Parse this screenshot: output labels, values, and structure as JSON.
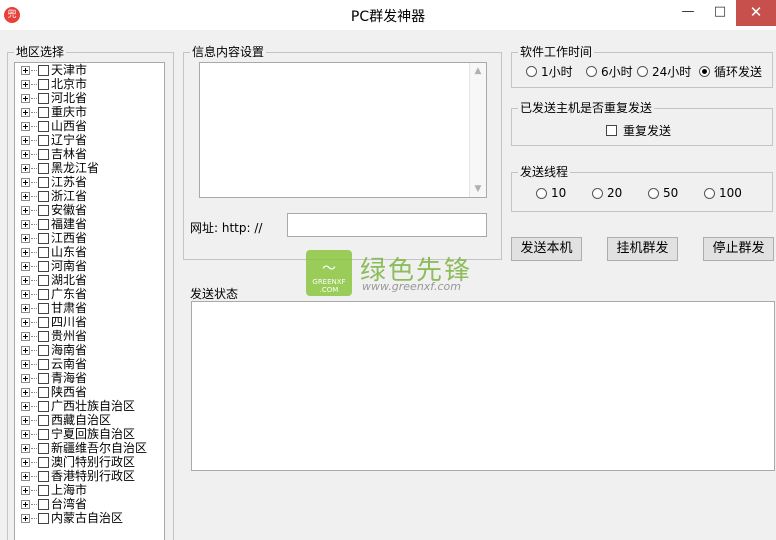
{
  "window": {
    "title": "PC群发神器",
    "icon_text": "兜",
    "min_glyph": "—",
    "max_glyph": "□",
    "close_glyph": "✕"
  },
  "region": {
    "label": "地区选择",
    "items": [
      "天津市",
      "北京市",
      "河北省",
      "重庆市",
      "山西省",
      "辽宁省",
      "吉林省",
      "黑龙江省",
      "江苏省",
      "浙江省",
      "安徽省",
      "福建省",
      "江西省",
      "山东省",
      "河南省",
      "湖北省",
      "广东省",
      "甘肃省",
      "四川省",
      "贵州省",
      "海南省",
      "云南省",
      "青海省",
      "陕西省",
      "广西壮族自治区",
      "西藏自治区",
      "宁夏回族自治区",
      "新疆维吾尔自治区",
      "澳门特别行政区",
      "香港特别行政区",
      "上海市",
      "台湾省",
      "内蒙古自治区"
    ]
  },
  "message": {
    "label": "信息内容设置",
    "content": "",
    "url_label": "网址: http: //",
    "url_value": ""
  },
  "work_time": {
    "label": "软件工作时间",
    "options": [
      "1小时",
      "6小时",
      "24小时",
      "循环发送"
    ],
    "selected": "循环发送"
  },
  "resend": {
    "label": "已发送主机是否重复发送",
    "checkbox_label": "重复发送",
    "checked": false
  },
  "threads": {
    "label": "发送线程",
    "options": [
      "10",
      "20",
      "50",
      "100"
    ],
    "selected": ""
  },
  "buttons": {
    "send_local": "发送本机",
    "hang_send": "挂机群发",
    "stop_send": "停止群发"
  },
  "status": {
    "label": "发送状态",
    "content": ""
  },
  "watermark": {
    "logo_top": "〜",
    "logo_line1": "GREENXF",
    "logo_line2": ".COM",
    "name": "绿色先锋",
    "url": "www.greenxf.com"
  },
  "colors": {
    "close_button": "#c7504c",
    "app_icon": "#e8413a",
    "watermark_green": "#8cc63f"
  }
}
